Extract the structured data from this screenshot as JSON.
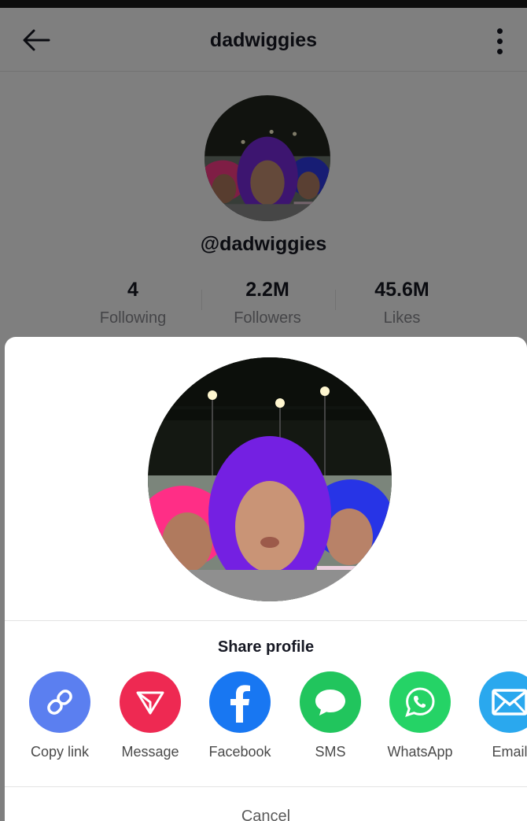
{
  "header": {
    "title": "dadwiggies"
  },
  "profile": {
    "handle": "@dadwiggies",
    "stats": [
      {
        "value": "4",
        "label": "Following"
      },
      {
        "value": "2.2M",
        "label": "Followers"
      },
      {
        "value": "45.6M",
        "label": "Likes"
      }
    ]
  },
  "share_sheet": {
    "title": "Share profile",
    "options": [
      {
        "label": "Copy link",
        "icon": "link-icon",
        "color": "#5b7ff0"
      },
      {
        "label": "Message",
        "icon": "send-icon",
        "color": "#ee2952"
      },
      {
        "label": "Facebook",
        "icon": "facebook-icon",
        "color": "#1877f2"
      },
      {
        "label": "SMS",
        "icon": "chat-bubble-icon",
        "color": "#21c55d"
      },
      {
        "label": "WhatsApp",
        "icon": "whatsapp-icon",
        "color": "#25d366"
      },
      {
        "label": "Email",
        "icon": "envelope-icon",
        "color": "#2aa8ee"
      }
    ],
    "cancel_label": "Cancel"
  }
}
